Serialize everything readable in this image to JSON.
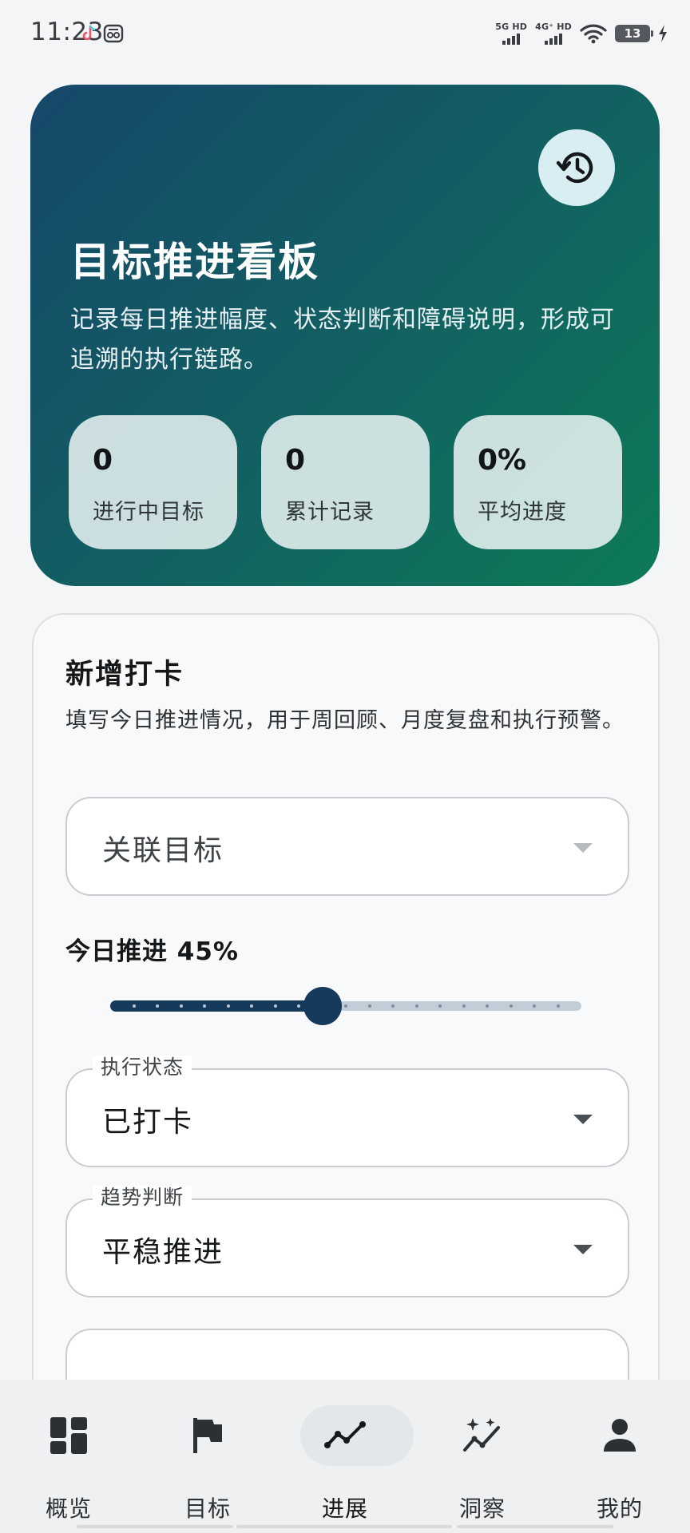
{
  "status_bar": {
    "time": "11:23",
    "network": [
      {
        "label": "5G HD"
      },
      {
        "label": "4G⁺ HD"
      }
    ],
    "battery": "13"
  },
  "hero": {
    "title": "目标推进看板",
    "description": "记录每日推进幅度、状态判断和障碍说明，形成可追溯的执行链路。",
    "history_icon": "history-icon",
    "stats": [
      {
        "value": "0",
        "label": "进行中目标"
      },
      {
        "value": "0",
        "label": "累计记录"
      },
      {
        "value": "0%",
        "label": "平均进度"
      }
    ]
  },
  "form": {
    "title": "新增打卡",
    "description": "填写今日推进情况，用于周回顾、月度复盘和执行预警。",
    "goal_select": {
      "placeholder": "关联目标"
    },
    "progress": {
      "label": "今日推进 45%",
      "value": 45,
      "min": 0,
      "max": 100,
      "step": 5
    },
    "status_select": {
      "label": "执行状态",
      "value": "已打卡"
    },
    "trend_select": {
      "label": "趋势判断",
      "value": "平稳推进"
    }
  },
  "bottom_nav": {
    "items": [
      {
        "label": "概览",
        "icon": "dashboard-icon",
        "active": false
      },
      {
        "label": "目标",
        "icon": "flag-icon",
        "active": false
      },
      {
        "label": "进展",
        "icon": "trending-line-icon",
        "active": true
      },
      {
        "label": "洞察",
        "icon": "insights-sparkle-icon",
        "active": false
      },
      {
        "label": "我的",
        "icon": "person-icon",
        "active": false
      }
    ]
  },
  "colors": {
    "accent": "#153a5c",
    "hero_gradient_start": "#16476a",
    "hero_gradient_end": "#0e7a57",
    "history_button": "#d8eef3"
  }
}
